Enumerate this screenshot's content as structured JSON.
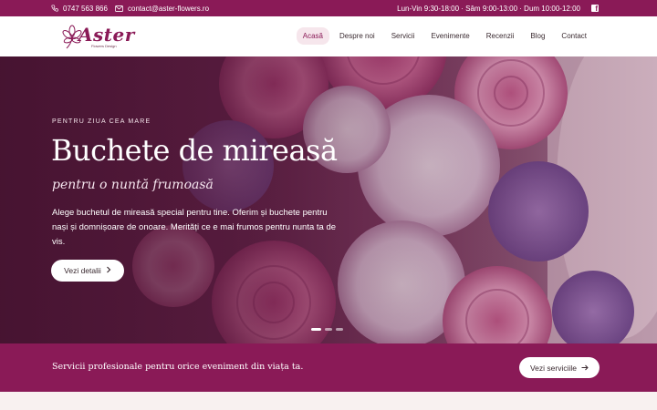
{
  "topbar": {
    "phone": "0747 563 866",
    "email": "contact@aster-flowers.ro",
    "hours": "Lun-Vin 9:30-18:00 · Sâm 9:00-13:00 · Dum 10:00-12:00",
    "facebook_icon": "facebook-icon"
  },
  "logo": {
    "word": "Aster",
    "tagline": "Flowers Design"
  },
  "nav": {
    "items": [
      "Acasă",
      "Despre noi",
      "Servicii",
      "Evenimente",
      "Recenzii",
      "Blog",
      "Contact"
    ],
    "active": "Acasă"
  },
  "hero": {
    "eyebrow": "PENTRU ZIUA CEA MARE",
    "title": "Buchete de mireasă",
    "subtitle": "pentru o nuntă frumoasă",
    "description": "Alege buchetul de mireasă special pentru tine. Oferim și buchete pentru nași și domnișoare de onoare. Merități ce e mai frumos pentru nunta ta de vis.",
    "cta_label": "Vezi detalii",
    "slides_total": 3,
    "slide_active": 1
  },
  "band": {
    "text": "Servicii profesionale pentru orice eveniment din viața ta.",
    "button_label": "Vezi serviciile"
  },
  "colors": {
    "brand": "#8a1a57",
    "active_nav_bg": "#f6e6ec",
    "white": "#ffffff"
  }
}
